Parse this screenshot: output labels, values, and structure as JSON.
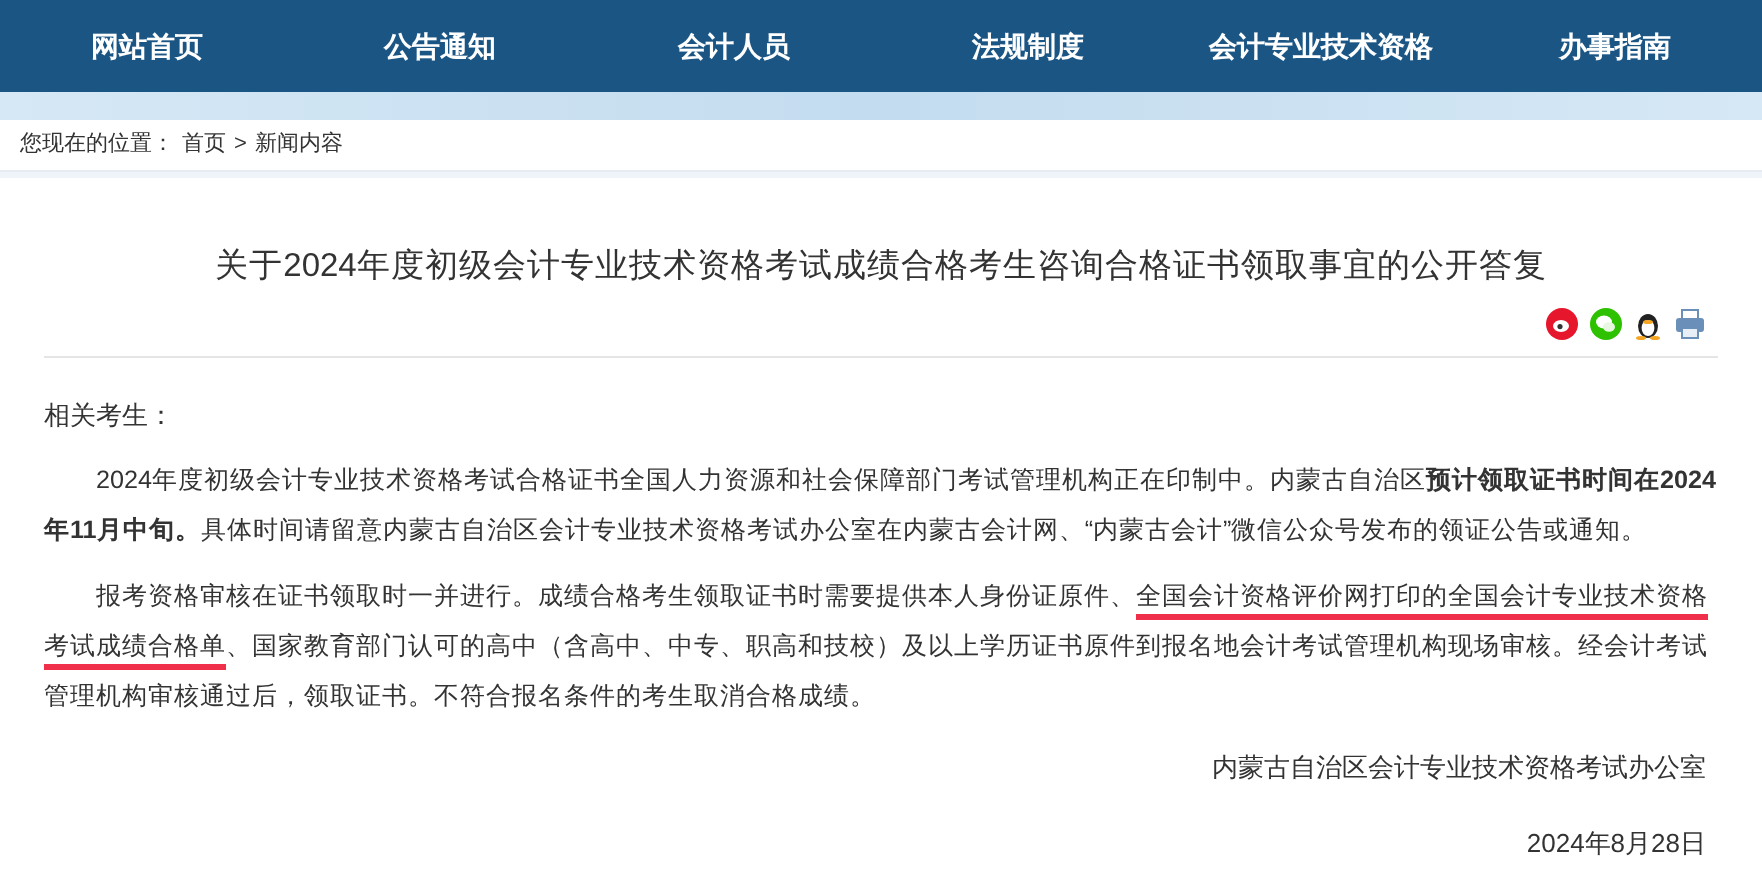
{
  "nav": [
    "网站首页",
    "公告通知",
    "会计人员",
    "法规制度",
    "会计专业技术资格",
    "办事指南"
  ],
  "breadcrumb": {
    "label": "您现在的位置：",
    "items": [
      "首页",
      "新闻内容"
    ],
    "separator": ">"
  },
  "article": {
    "title": "关于2024年度初级会计专业技术资格考试成绩合格考生咨询合格证书领取事宜的公开答复",
    "share": [
      {
        "kind": "weibo"
      },
      {
        "kind": "wechat"
      },
      {
        "kind": "qq"
      },
      {
        "kind": "print"
      }
    ],
    "greeting": "相关考生：",
    "paragraphs": [
      [
        {
          "text": "2024年度初级会计专业技术资格考试合格证书全国人力资源和社会保障部门考试管理机构正在印制中。内蒙古自治区**预计领取证书时间在2024年11月中旬。**具体时间请留意内蒙古自治区会计专业技术资格考试办公室在内蒙古会计网、“内蒙古会计”微信公众号发布的领证公告或通知。"
        }
      ],
      [
        {
          "text": "报考资格审核在证书领取时一并进行。成绩合格考生领取证书时需要提供本人身份证原件、"
        },
        {
          "text": "全国会计资格评价网打印的全国会计专业技术资格考试成绩合格单",
          "marked": true
        },
        {
          "text": "、国家教育部门认可的高中（含高中、中专、职高和技校）及以上学历证书原件到报名地会计考试管理机构现场审核。经会计考试管理机构审核通过后，领取证书。不符合报名条件的考生取消合格成绩。"
        }
      ]
    ],
    "signature": "内蒙古自治区会计专业技术资格考试办公室",
    "date": "2024年8月28日"
  }
}
